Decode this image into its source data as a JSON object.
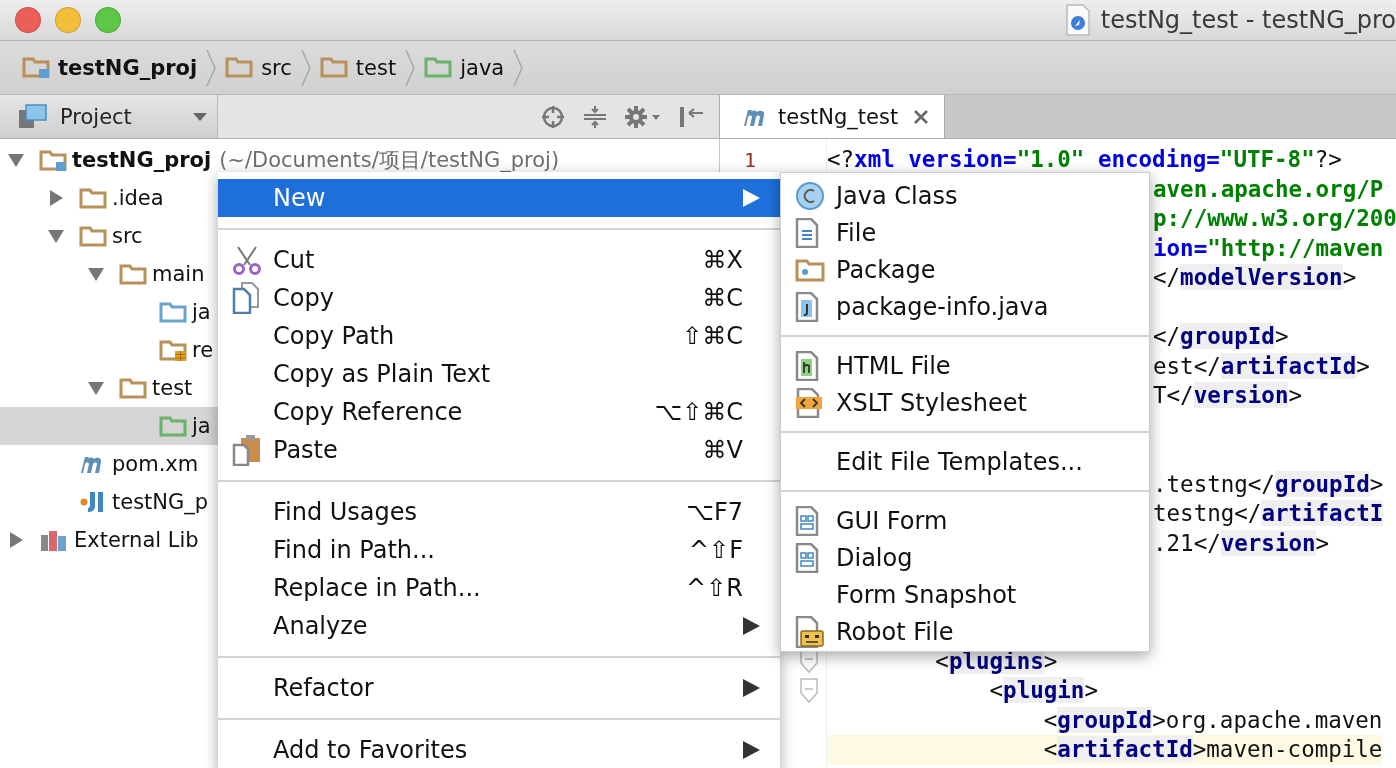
{
  "window": {
    "title": "testNg_test - testNG_pro"
  },
  "breadcrumbs": [
    {
      "label": "testNG_proj",
      "kind": "module"
    },
    {
      "label": "src",
      "kind": "folder"
    },
    {
      "label": "test",
      "kind": "folder"
    },
    {
      "label": "java",
      "kind": "test"
    }
  ],
  "tool_window": {
    "title": "Project"
  },
  "editor_tabs": [
    {
      "label": "testNg_test",
      "selected": true
    }
  ],
  "project_tree": [
    {
      "label": "testNG_proj",
      "note": "(~/Documents/项目/testNG_proj)",
      "kind": "module",
      "expanded": true,
      "selected": false,
      "children": [
        {
          "label": ".idea",
          "kind": "folder",
          "expanded": false,
          "selected": false
        },
        {
          "label": "src",
          "kind": "folder",
          "expanded": true,
          "selected": false,
          "children": [
            {
              "label": "main",
              "kind": "folder",
              "expanded": true,
              "selected": false,
              "children": [
                {
                  "label": "ja",
                  "kind": "source",
                  "selected": false
                },
                {
                  "label": "re",
                  "kind": "resource",
                  "selected": false
                }
              ]
            },
            {
              "label": "test",
              "kind": "folder",
              "expanded": true,
              "selected": false,
              "children": [
                {
                  "label": "ja",
                  "kind": "test",
                  "selected": true
                }
              ]
            }
          ]
        },
        {
          "label": "pom.xm",
          "kind": "maven",
          "selected": false
        },
        {
          "label": "testNG_p",
          "kind": "iml",
          "selected": false
        }
      ]
    },
    {
      "label": "External Lib",
      "kind": "library",
      "expanded": false,
      "selected": false
    }
  ],
  "editor_lines": [
    {
      "number": "1",
      "kind": "full",
      "segments": [
        {
          "kind": "p",
          "text": "<?"
        },
        {
          "kind": "attr",
          "text": "xml version="
        },
        {
          "kind": "str",
          "text": "\"1.0\""
        },
        {
          "kind": "attr",
          "text": " encoding="
        },
        {
          "kind": "str",
          "text": "\"UTF-8\""
        },
        {
          "kind": "p",
          "text": "?>"
        }
      ]
    },
    {
      "kind": "after-menu",
      "segments": [
        {
          "kind": "str",
          "text": "aven.apache.org/P"
        }
      ]
    },
    {
      "kind": "after-menu",
      "segments": [
        {
          "kind": "str",
          "text": "p://www.w3.org/200"
        }
      ]
    },
    {
      "kind": "after-menu",
      "segments": [
        {
          "kind": "attr",
          "text": "ion="
        },
        {
          "kind": "str",
          "text": "\"http://maven"
        }
      ]
    },
    {
      "kind": "after-menu",
      "segments": [
        {
          "kind": "p",
          "text": "</"
        },
        {
          "kind": "tag",
          "text": "modelVersion"
        },
        {
          "kind": "p",
          "text": ">"
        }
      ]
    },
    {
      "kind": "covered"
    },
    {
      "kind": "after-menu",
      "segments": [
        {
          "kind": "p",
          "text": "</"
        },
        {
          "kind": "tag",
          "text": "groupId"
        },
        {
          "kind": "p",
          "text": ">"
        }
      ]
    },
    {
      "kind": "after-menu",
      "segments": [
        {
          "kind": "text",
          "text": "est"
        },
        {
          "kind": "p",
          "text": "</"
        },
        {
          "kind": "tag",
          "text": "artifactId"
        },
        {
          "kind": "p",
          "text": ">"
        }
      ]
    },
    {
      "kind": "after-menu",
      "segments": [
        {
          "kind": "text",
          "text": "T"
        },
        {
          "kind": "p",
          "text": "</"
        },
        {
          "kind": "tag",
          "text": "version"
        },
        {
          "kind": "p",
          "text": ">"
        }
      ]
    },
    {
      "kind": "covered"
    },
    {
      "kind": "covered"
    },
    {
      "kind": "after-menu",
      "segments": [
        {
          "kind": "text",
          "text": ".testng"
        },
        {
          "kind": "p",
          "text": "</"
        },
        {
          "kind": "tag",
          "text": "groupId"
        },
        {
          "kind": "p",
          "text": ">"
        }
      ]
    },
    {
      "kind": "after-menu",
      "segments": [
        {
          "kind": "text",
          "text": "testng"
        },
        {
          "kind": "p",
          "text": "</"
        },
        {
          "kind": "tag",
          "text": "artifactI"
        }
      ]
    },
    {
      "kind": "after-menu",
      "segments": [
        {
          "kind": "text",
          "text": ".21"
        },
        {
          "kind": "p",
          "text": "</"
        },
        {
          "kind": "tag",
          "text": "version"
        },
        {
          "kind": "p",
          "text": ">"
        }
      ]
    },
    {
      "kind": "covered"
    },
    {
      "kind": "covered"
    },
    {
      "kind": "covered"
    },
    {
      "kind": "full",
      "fold": true,
      "segments": [
        {
          "kind": "p",
          "text": "        <"
        },
        {
          "kind": "tag",
          "text": "plugins"
        },
        {
          "kind": "p",
          "text": ">"
        }
      ]
    },
    {
      "kind": "full",
      "fold": true,
      "segments": [
        {
          "kind": "p",
          "text": "            <"
        },
        {
          "kind": "tag",
          "text": "plugin"
        },
        {
          "kind": "p",
          "text": ">"
        }
      ]
    },
    {
      "kind": "full",
      "segments": [
        {
          "kind": "p",
          "text": "                <"
        },
        {
          "kind": "tag",
          "text": "groupId"
        },
        {
          "kind": "p",
          "text": ">"
        },
        {
          "kind": "text",
          "text": "org.apache.maven"
        }
      ]
    },
    {
      "kind": "full",
      "current": true,
      "segments": [
        {
          "kind": "p",
          "text": "                <"
        },
        {
          "kind": "tag",
          "text": "artifactId"
        },
        {
          "kind": "p",
          "text": ">"
        },
        {
          "kind": "text",
          "text": "maven-compile"
        }
      ]
    }
  ],
  "context_menu": {
    "items": [
      {
        "kind": "plain",
        "label": "New",
        "submenu": true,
        "selected": true
      },
      {
        "kind": "separator"
      },
      {
        "kind": "scissors",
        "label": "Cut",
        "shortcut": "⌘X",
        "selected": false
      },
      {
        "kind": "copy",
        "label": "Copy",
        "shortcut": "⌘C",
        "selected": false
      },
      {
        "kind": "plain",
        "label": "Copy Path",
        "shortcut": "⇧⌘C",
        "selected": false
      },
      {
        "kind": "plain",
        "label": "Copy as Plain Text",
        "selected": false
      },
      {
        "kind": "plain",
        "label": "Copy Reference",
        "shortcut": "⌥⇧⌘C",
        "selected": false
      },
      {
        "kind": "paste",
        "label": "Paste",
        "shortcut": "⌘V",
        "selected": false
      },
      {
        "kind": "separator"
      },
      {
        "kind": "plain",
        "label": "Find Usages",
        "shortcut": "⌥F7",
        "selected": false
      },
      {
        "kind": "plain",
        "label": "Find in Path...",
        "shortcut": "^⇧F",
        "selected": false
      },
      {
        "kind": "plain",
        "label": "Replace in Path...",
        "shortcut": "^⇧R",
        "selected": false
      },
      {
        "kind": "plain",
        "label": "Analyze",
        "submenu": true,
        "selected": false
      },
      {
        "kind": "separator"
      },
      {
        "kind": "plain",
        "label": "Refactor",
        "submenu": true,
        "selected": false
      },
      {
        "kind": "separator"
      },
      {
        "kind": "plain",
        "label": "Add to Favorites",
        "submenu": true,
        "selected": false
      }
    ]
  },
  "new_submenu": {
    "items": [
      {
        "kind": "class",
        "label": "Java Class"
      },
      {
        "kind": "file",
        "label": "File"
      },
      {
        "kind": "package",
        "label": "Package"
      },
      {
        "kind": "javafile",
        "label": "package-info.java"
      },
      {
        "kind": "separator"
      },
      {
        "kind": "html",
        "label": "HTML File"
      },
      {
        "kind": "xslt",
        "label": "XSLT Stylesheet"
      },
      {
        "kind": "separator"
      },
      {
        "kind": "plain",
        "label": "Edit File Templates..."
      },
      {
        "kind": "separator"
      },
      {
        "kind": "form",
        "label": "GUI Form"
      },
      {
        "kind": "form",
        "label": "Dialog"
      },
      {
        "kind": "plain",
        "label": "Form Snapshot"
      },
      {
        "kind": "robot",
        "label": "Robot File"
      }
    ]
  }
}
